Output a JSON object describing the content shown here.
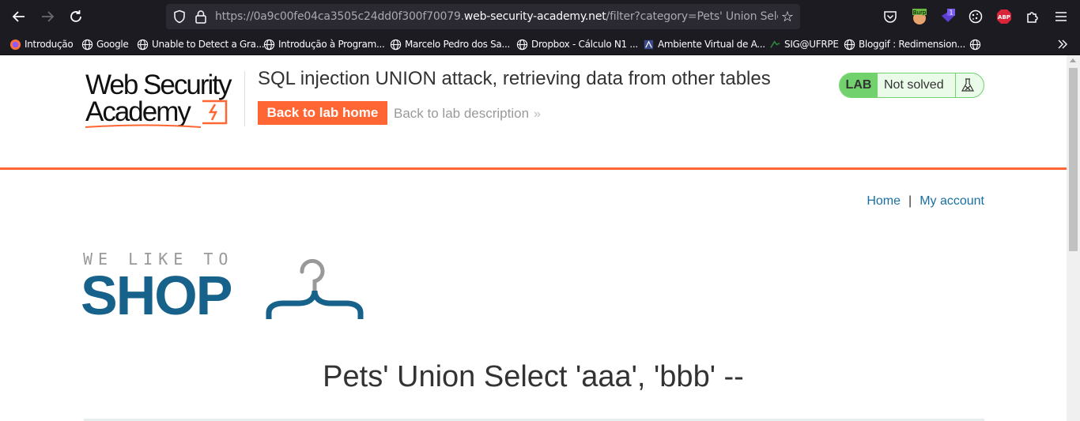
{
  "browser": {
    "url_prefix": "https://0a9c00fe04ca3505c24dd0f300f70079.",
    "url_host": "web-security-academy.net",
    "url_suffix": "/filter?category=Pets' Union Select 'aaa', 'bbb' --",
    "extensions": [
      "pocket-icon",
      "burp-icon",
      "badge-extension-icon",
      "cookie-icon",
      "adblock-icon",
      "extensions-icon",
      "menu-icon"
    ],
    "ext_burp_label": "Burp",
    "ext_badge_count": "1",
    "ext_abp_label": "ABP",
    "bookmarks": [
      {
        "label": "Introdução",
        "icon": "firefox-icon"
      },
      {
        "label": "Google",
        "icon": "globe-icon"
      },
      {
        "label": "Unable to Detect a Gra...",
        "icon": "globe-icon"
      },
      {
        "label": "Introdução à Program...",
        "icon": "globe-icon"
      },
      {
        "label": "Marcelo Pedro dos Sa...",
        "icon": "globe-icon"
      },
      {
        "label": "Dropbox - Cálculo N1 ...",
        "icon": "globe-icon"
      },
      {
        "label": "Ambiente Virtual de A...",
        "icon": "ava-icon"
      },
      {
        "label": "SIG@UFRPE",
        "icon": "sig-icon"
      },
      {
        "label": "Bloggif : Redimension...",
        "icon": "globe-icon"
      }
    ]
  },
  "header": {
    "logo_line1": "Web Security",
    "logo_line2": "Academy",
    "lab_title": "SQL injection UNION attack, retrieving data from other tables",
    "back_home_label": "Back to lab home",
    "back_description_label": "Back to lab description",
    "lab_badge": "LAB",
    "lab_status": "Not solved"
  },
  "nav": {
    "home_label": "Home",
    "separator": "|",
    "account_label": "My account"
  },
  "shop": {
    "tagline": "WE LIKE TO",
    "brand": "SHOP"
  },
  "main": {
    "category_title": "Pets' Union Select 'aaa', 'bbb' --"
  },
  "colors": {
    "accent": "#ff6633",
    "lab_green": "#70d16d",
    "link_blue": "#1a6fa1",
    "shop_blue": "#16628a"
  }
}
